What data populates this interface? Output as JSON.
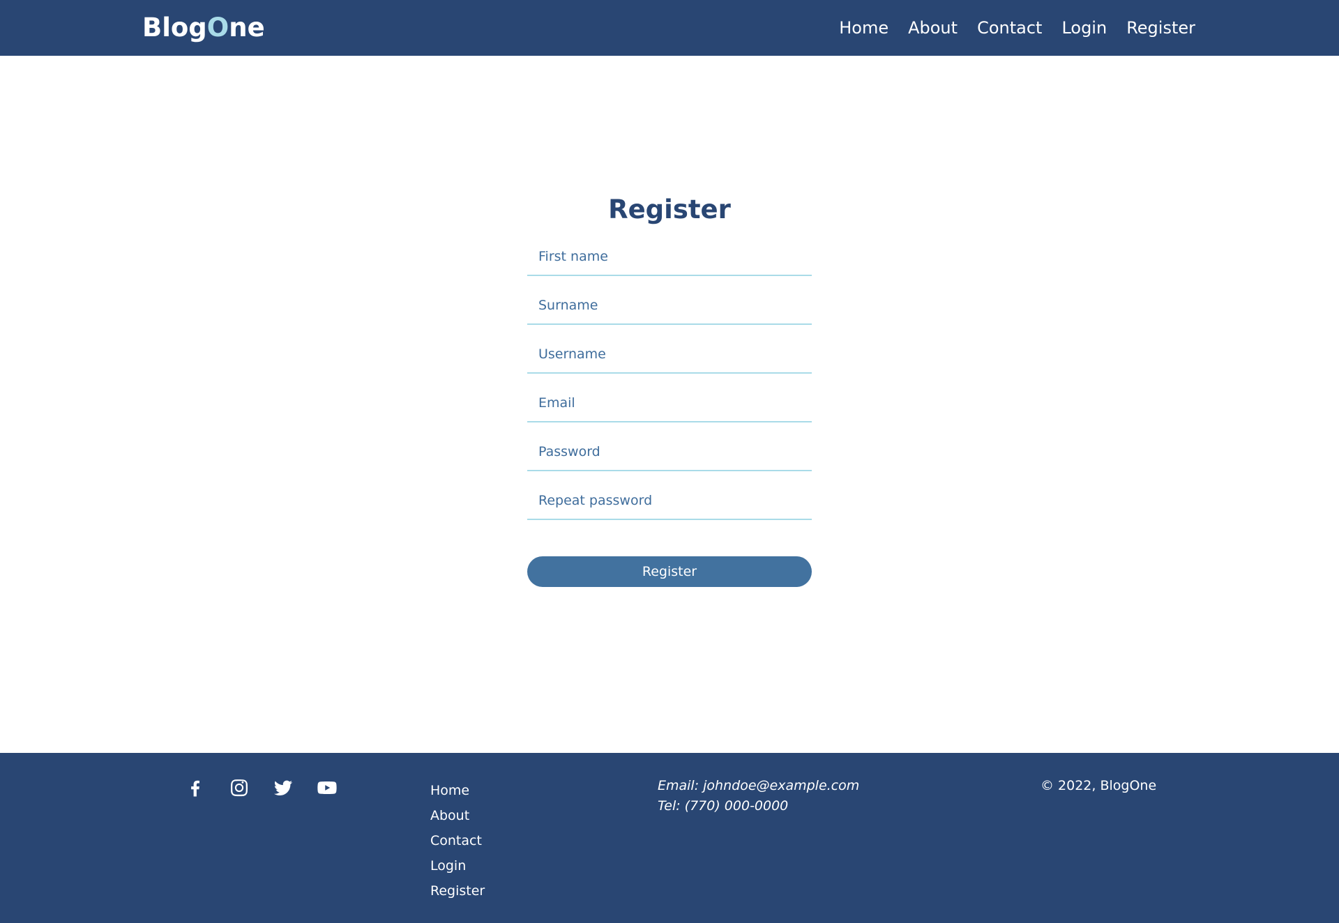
{
  "navbar": {
    "logo_prefix": "Blog",
    "logo_accent": "O",
    "logo_suffix": "ne",
    "links": [
      "Home",
      "About",
      "Contact",
      "Login",
      "Register"
    ]
  },
  "form": {
    "title": "Register",
    "fields": {
      "first_name": "First name",
      "surname": "Surname",
      "username": "Username",
      "email": "Email",
      "password": "Password",
      "repeat_password": "Repeat password"
    },
    "submit_label": "Register"
  },
  "footer": {
    "social_icons": [
      "facebook-icon",
      "instagram-icon",
      "twitter-icon",
      "youtube-icon"
    ],
    "links": [
      "Home",
      "About",
      "Contact",
      "Login",
      "Register"
    ],
    "email": "Email: johndoe@example.com",
    "tel": "Tel: (770) 000-0000",
    "copyright": "© 2022, BlogOne"
  },
  "colors": {
    "navy": "#294673",
    "accent": "#a9dbe8",
    "button": "#42729f",
    "field_text": "#3f6d9c"
  }
}
